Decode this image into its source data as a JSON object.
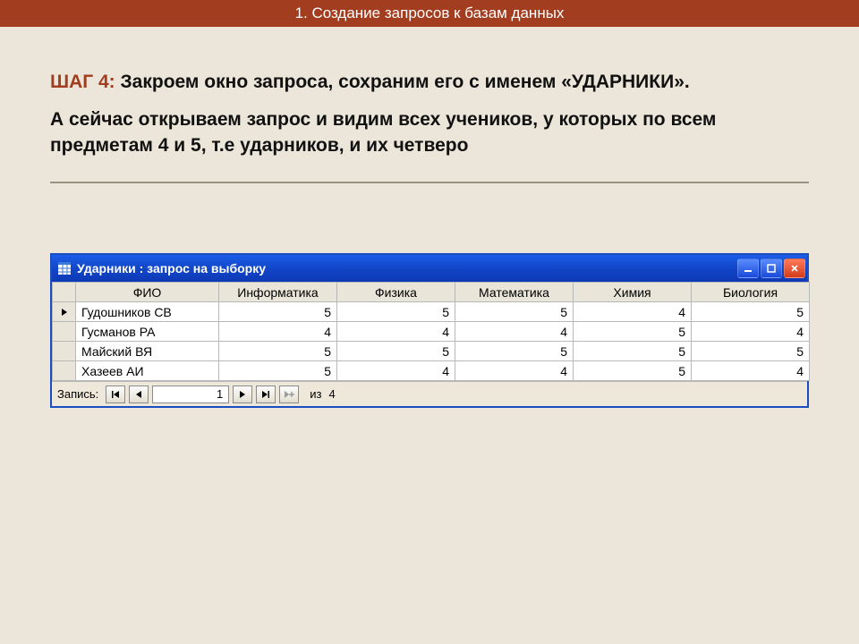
{
  "header": {
    "title": "1. Создание запросов к базам данных"
  },
  "slide": {
    "step_label": "ШАГ 4:",
    "step_text": "Закроем окно запроса, сохраним его с именем «УДАРНИКИ».",
    "body_text": " А сейчас открываем запрос и видим всех учеников, у которых по всем предметам 4 и 5, т.е ударников, и их четверо"
  },
  "window": {
    "title": "Ударники : запрос на выборку",
    "columns": [
      "ФИО",
      "Информатика",
      "Физика",
      "Математика",
      "Химия",
      "Биология"
    ],
    "rows": [
      {
        "name": "Гудошников СВ",
        "vals": [
          5,
          5,
          5,
          4,
          5
        ]
      },
      {
        "name": "Гусманов РА",
        "vals": [
          4,
          4,
          4,
          5,
          4
        ]
      },
      {
        "name": "Майский ВЯ",
        "vals": [
          5,
          5,
          5,
          5,
          5
        ]
      },
      {
        "name": "Хазеев АИ",
        "vals": [
          5,
          4,
          4,
          5,
          4
        ]
      }
    ],
    "nav": {
      "label": "Запись:",
      "current": "1",
      "of_label": "из",
      "total": "4"
    }
  }
}
